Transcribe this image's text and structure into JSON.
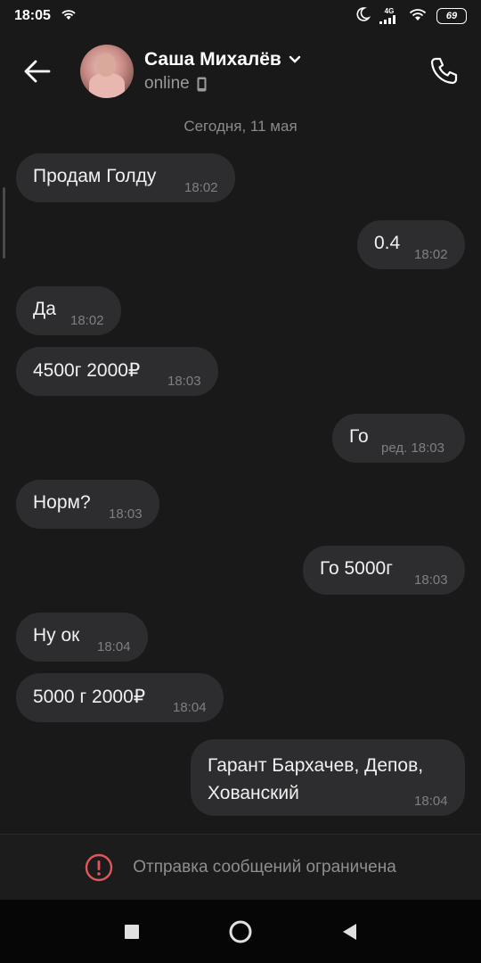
{
  "status_bar": {
    "time": "18:05",
    "network_type": "4G",
    "battery": "69",
    "icons": [
      "wifi-icon",
      "moon-icon",
      "signal-icon",
      "battery-icon"
    ]
  },
  "header": {
    "contact_name": "Саша Михалёв",
    "status": "online",
    "icons": [
      "back-arrow-icon",
      "chevron-down-icon",
      "mobile-device-icon",
      "phone-icon"
    ]
  },
  "date_separator": "Сегодня, 11 мая",
  "messages": [
    {
      "direction": "incoming",
      "text": "Продам Голду",
      "time": "18:02"
    },
    {
      "direction": "outgoing",
      "text": "0.4",
      "time": "18:02"
    },
    {
      "direction": "incoming",
      "text": "Да",
      "time": "18:02"
    },
    {
      "direction": "incoming",
      "text": "4500г 2000₽",
      "time": "18:03"
    },
    {
      "direction": "outgoing",
      "text": "Го",
      "time": "ред. 18:03"
    },
    {
      "direction": "incoming",
      "text": "Норм?",
      "time": "18:03"
    },
    {
      "direction": "outgoing",
      "text": "Го 5000г",
      "time": "18:03"
    },
    {
      "direction": "incoming",
      "text": "Ну ок",
      "time": "18:04"
    },
    {
      "direction": "incoming",
      "text": "5000 г 2000₽",
      "time": "18:04"
    },
    {
      "direction": "outgoing",
      "text": "Гарант Бархачев, Депов, Хованский",
      "time": "18:04"
    }
  ],
  "restricted_banner": {
    "text": "Отправка сообщений ограничена",
    "icon": "alert-circle-icon",
    "color": "#e0575b"
  },
  "nav_bar": {
    "icons": [
      "recents-square-icon",
      "home-circle-icon",
      "back-triangle-icon"
    ]
  },
  "colors": {
    "background": "#19191a",
    "bubble": "#2d2d2f",
    "text": "#f0f0f0",
    "secondary_text": "#8a8a8e"
  }
}
